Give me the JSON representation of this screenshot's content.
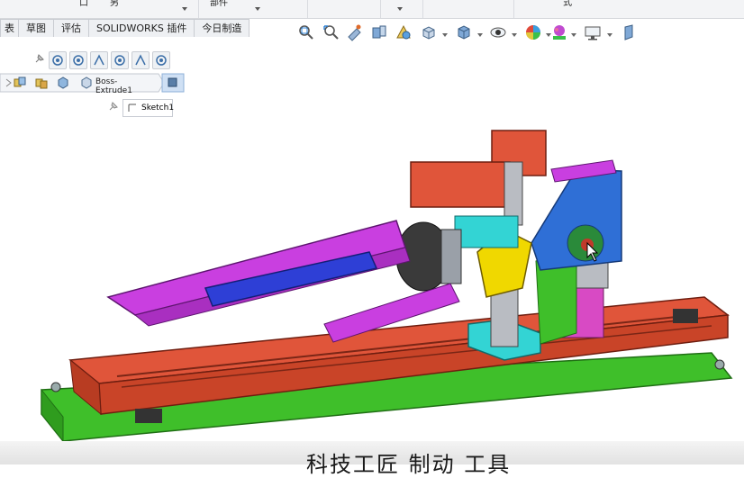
{
  "top_menu": {
    "items": [
      {
        "label": "口"
      },
      {
        "label": "另"
      },
      {
        "label": "部件"
      },
      {
        "label": "式"
      }
    ]
  },
  "tabs": [
    {
      "label": "表"
    },
    {
      "label": "草图"
    },
    {
      "label": "评估"
    },
    {
      "label": "SOLIDWORKS 插件"
    },
    {
      "label": "今日制造"
    }
  ],
  "view_toolbar": {
    "icons": [
      "zoom-to-fit-icon",
      "zoom-to-area-icon",
      "previous-view-icon",
      "section-view-icon",
      "dynamic-annotation-icon",
      "view-orientation-icon",
      "display-style-icon",
      "hide-show-icon",
      "edit-appearance-icon",
      "apply-scene-icon",
      "view-settings-icon",
      "3d-view-icon"
    ]
  },
  "selection_filter": {
    "icons": [
      "pin-icon",
      "circle-filter-icon",
      "circle-filter-icon",
      "angle-filter-icon",
      "circle-filter-icon",
      "angle-filter-icon",
      "circle-filter-icon"
    ]
  },
  "breadcrumb": {
    "feature": "Boss-Extrude1",
    "sketch": "Sketch1"
  },
  "caption": {
    "text": "科技工匠  制动  工具"
  },
  "colors": {
    "rail": "#e0553a",
    "base": "#3fbf2a",
    "purple": "#c93fe0",
    "blue_plate": "#2f6fd6",
    "cyan": "#33d4d4",
    "yellow": "#f0d800",
    "gray": "#b9bcc2"
  }
}
